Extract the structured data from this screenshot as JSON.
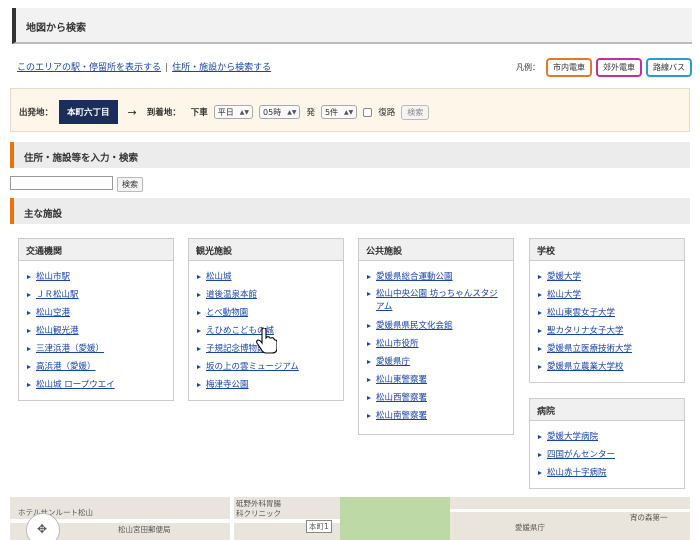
{
  "page_title": "地図から検索",
  "top_links": [
    "このエリアの駅・停留所を表示する",
    "住所・施設から検索する"
  ],
  "top_links_sep": "|",
  "legend": {
    "label": "凡例：",
    "items": [
      "市内電車",
      "郊外電車",
      "路線バス"
    ]
  },
  "route_search": {
    "origin_label": "出発地：",
    "origin_value": "本町六丁目",
    "arrow": "→",
    "destination_label": "到着地：",
    "board_label": "下車",
    "day_select": "平日",
    "hour_select": "05時",
    "depart_label": "発",
    "count_select": "5件",
    "return_label": "復路",
    "search_button": "検索"
  },
  "address_section": {
    "title": "住所・施設等を入力・検索",
    "search_button": "検索",
    "input_value": ""
  },
  "facilities_section": {
    "title": "主な施設"
  },
  "categories": [
    {
      "title": "交通機関",
      "items": [
        "松山市駅",
        "ＪＲ松山駅",
        "松山空港",
        "松山観光港",
        "三津浜港（愛媛）",
        "高浜港（愛媛）",
        "松山城 ロープウエイ"
      ]
    },
    {
      "title": "観光施設",
      "items": [
        "松山城",
        "道後温泉本館",
        "とべ動物園",
        "えひめこどもの城",
        "子規記念博物館",
        "坂の上の雲ミュージアム",
        "梅津寺公園"
      ]
    },
    {
      "title": "公共施設",
      "items": [
        "愛媛県総合運動公園",
        "松山中央公園 坊っちゃんスタジアム",
        "愛媛県県民文化会館",
        "松山市役所",
        "愛媛県庁",
        "松山東警察署",
        "松山西警察署",
        "松山南警察署"
      ]
    },
    {
      "title": "学校",
      "items": [
        "愛媛大学",
        "松山大学",
        "松山東雲女子大学",
        "聖カタリナ女子大学",
        "愛媛県立医療技術大学",
        "愛媛県立農業大学校"
      ]
    },
    {
      "title": "病院",
      "items": [
        "愛媛大学病院",
        "四国がんセンター",
        "松山赤十字病院"
      ]
    }
  ],
  "map": {
    "labels": [
      "ホテルサンルート松山",
      "松山宮田郵便局",
      "砥野外科胃腸",
      "科クリニック",
      "本町1",
      "愛媛県庁",
      "宵の森第一"
    ]
  },
  "colors": {
    "accent": "#e8730f",
    "origin_bg": "#1b2e5a",
    "link": "#1a44a8",
    "legend_city": "#e07a2a",
    "legend_sub": "#c0309a",
    "legend_bus": "#2a9bd0"
  }
}
